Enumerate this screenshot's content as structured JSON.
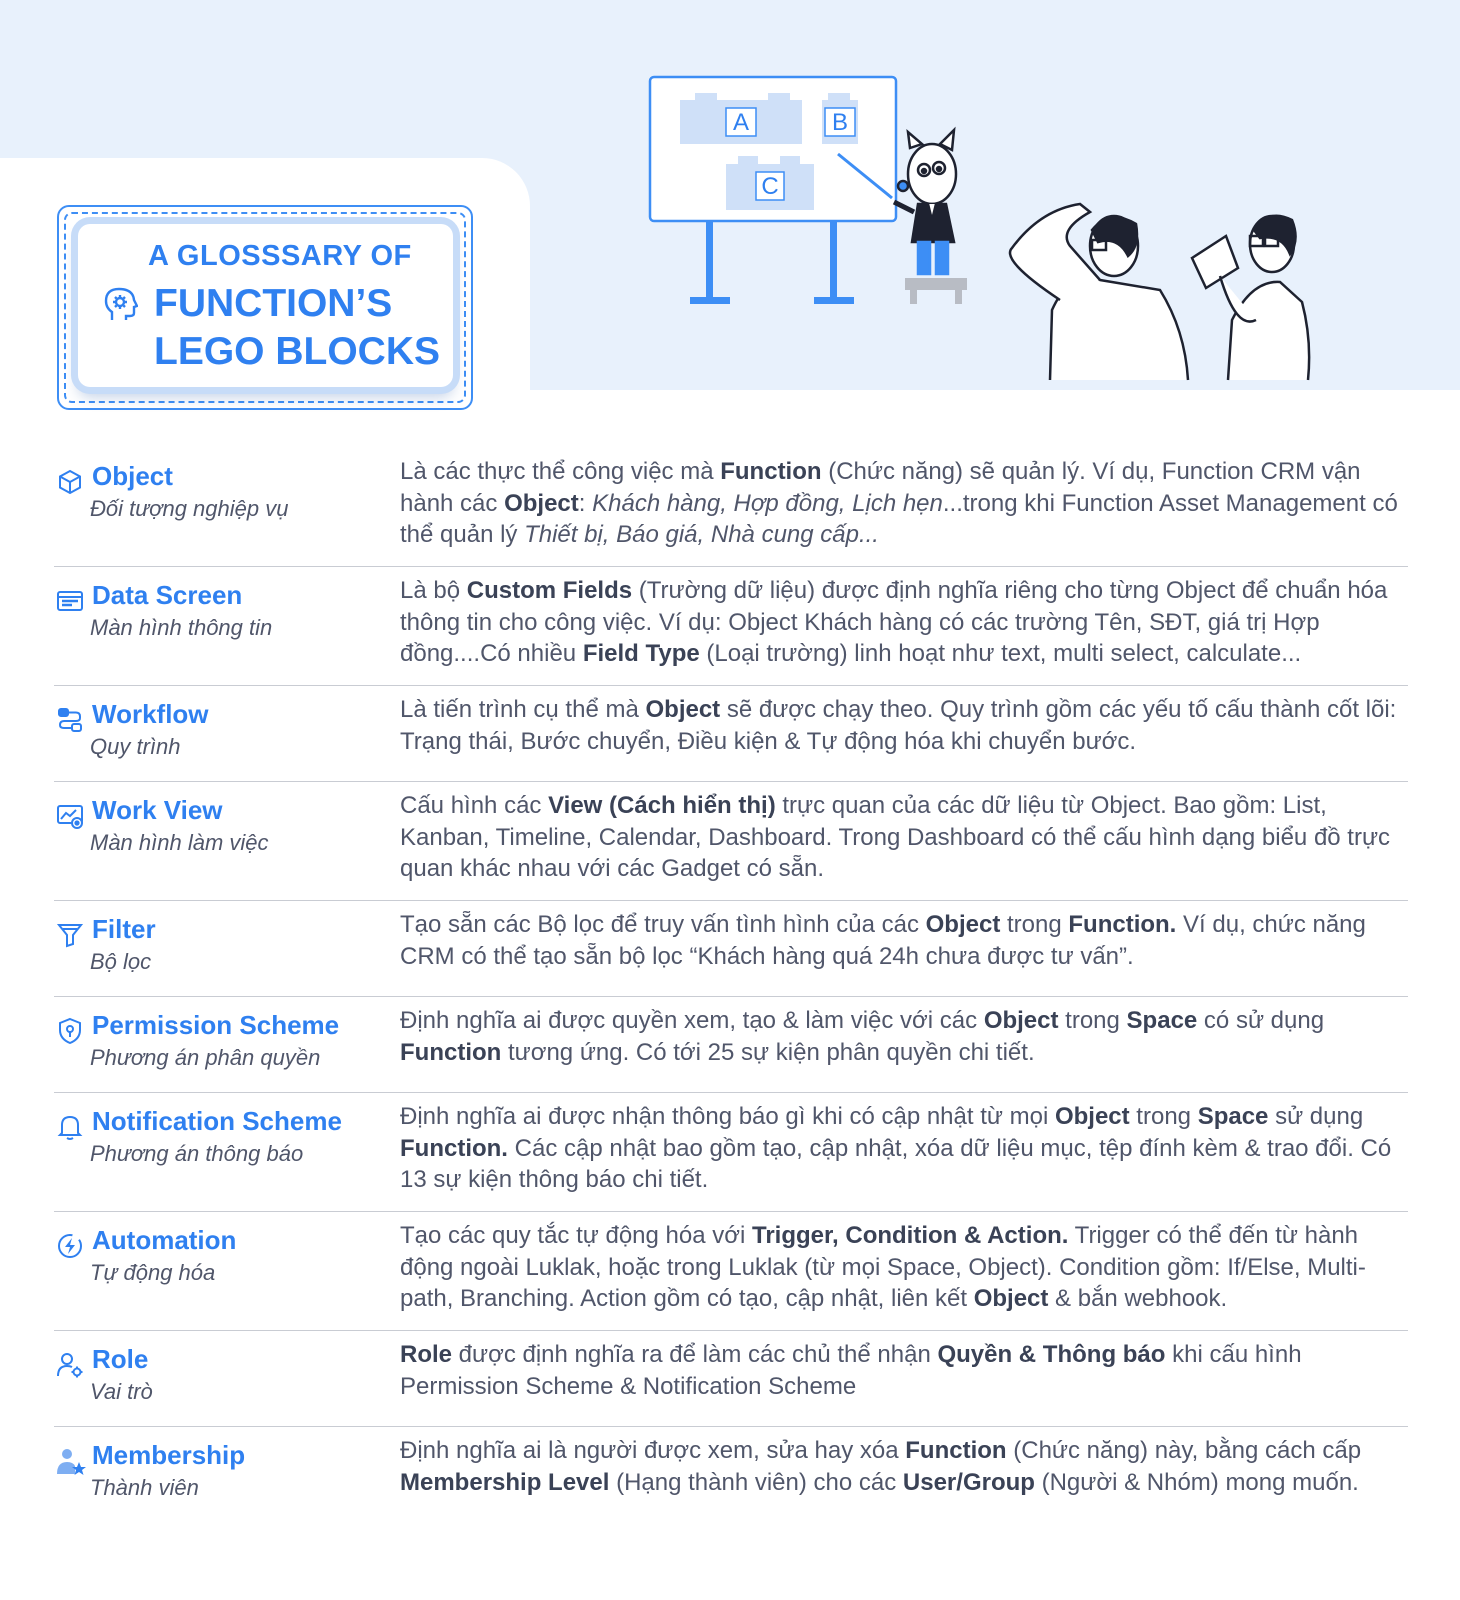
{
  "header": {
    "title_line1": "A GLOSSSARY OF",
    "title_line2": "FUNCTION’S",
    "title_line3": "LEGO BLOCKS",
    "board_labels": [
      "A",
      "B",
      "C"
    ]
  },
  "colors": {
    "accent": "#2f80f0",
    "hero_bg": "#e8f1fc",
    "text": "#50566a",
    "divider": "#c9ccd3"
  },
  "glossary": [
    {
      "icon": "cube-icon",
      "term": "Object",
      "subtitle": "Đối tượng nghiệp vụ",
      "desc": [
        {
          "t": "Là các thực thể công việc mà "
        },
        {
          "t": "Function",
          "b": true
        },
        {
          "t": " (Chức năng) sẽ quản lý. Ví dụ, Function CRM vận hành các "
        },
        {
          "t": "Object",
          "b": true
        },
        {
          "t": ": "
        },
        {
          "t": "Khách hàng, Hợp đồng, Lịch hẹn",
          "i": true
        },
        {
          "t": "...trong khi Function Asset Management có thể quản lý "
        },
        {
          "t": "Thiết bị, Báo giá, Nhà cung cấp...",
          "i": true
        }
      ]
    },
    {
      "icon": "screen-icon",
      "term": "Data Screen",
      "subtitle": "Màn hình thông tin",
      "desc": [
        {
          "t": "Là bộ "
        },
        {
          "t": "Custom Fields",
          "b": true
        },
        {
          "t": " (Trường dữ liệu) được định nghĩa riêng cho từng Object để chuẩn hóa thông tin cho công việc. Ví dụ: Object Khách hàng có các trường Tên, SĐT, giá trị Hợp đồng....Có nhiều "
        },
        {
          "t": "Field Type",
          "b": true
        },
        {
          "t": " (Loại trường) linh hoạt như text, multi select, calculate..."
        }
      ]
    },
    {
      "icon": "workflow-icon",
      "term": "Workflow",
      "subtitle": "Quy trình",
      "desc": [
        {
          "t": "Là tiến trình cụ thể mà "
        },
        {
          "t": "Object",
          "b": true
        },
        {
          "t": " sẽ được chạy theo. Quy trình gồm các yếu tố cấu thành cốt lõi: Trạng thái, Bước chuyển, Điều kiện & Tự động hóa khi chuyển bước."
        }
      ]
    },
    {
      "icon": "chart-view-icon",
      "term": "Work View",
      "subtitle": "Màn hình làm việc",
      "desc": [
        {
          "t": "Cấu hình các "
        },
        {
          "t": "View (Cách hiển thị)",
          "b": true
        },
        {
          "t": " trực quan của các dữ liệu từ Object. Bao gồm: List, Kanban, Timeline, Calendar, Dashboard. Trong Dashboard có thể cấu hình dạng biểu đồ trực quan khác nhau với các Gadget có sẵn."
        }
      ]
    },
    {
      "icon": "filter-icon",
      "term": "Filter",
      "subtitle": "Bộ lọc",
      "desc": [
        {
          "t": "Tạo sẵn các Bộ lọc để truy vấn tình hình của các "
        },
        {
          "t": "Object",
          "b": true
        },
        {
          "t": " trong "
        },
        {
          "t": "Function.",
          "b": true
        },
        {
          "t": " Ví dụ, chức năng CRM có thể tạo sẵn bộ lọc “Khách hàng quá 24h chưa được tư vấn”."
        }
      ]
    },
    {
      "icon": "shield-icon",
      "term": "Permission Scheme",
      "subtitle": "Phương án phân quyền",
      "desc": [
        {
          "t": "Định nghĩa ai được quyền xem, tạo & làm việc với các "
        },
        {
          "t": "Object",
          "b": true
        },
        {
          "t": " trong "
        },
        {
          "t": "Space",
          "b": true
        },
        {
          "t": " có sử dụng "
        },
        {
          "t": "Function",
          "b": true
        },
        {
          "t": " tương ứng. Có tới 25 sự kiện phân quyền chi tiết."
        }
      ]
    },
    {
      "icon": "bell-icon",
      "term": "Notification Scheme",
      "subtitle": "Phương án thông báo",
      "desc": [
        {
          "t": "Định nghĩa ai được nhận thông báo gì khi có cập nhật từ mọi "
        },
        {
          "t": "Object",
          "b": true
        },
        {
          "t": " trong "
        },
        {
          "t": "Space",
          "b": true
        },
        {
          "t": " sử dụng "
        },
        {
          "t": "Function.",
          "b": true
        },
        {
          "t": " Các cập nhật bao gồm tạo, cập nhật, xóa dữ liệu mục, tệp đính kèm & trao đổi. Có 13 sự kiện thông báo chi tiết."
        }
      ]
    },
    {
      "icon": "lightning-icon",
      "term": "Automation",
      "subtitle": "Tự động hóa",
      "desc": [
        {
          "t": "Tạo các quy tắc tự động hóa với "
        },
        {
          "t": "Trigger, Condition & Action.",
          "b": true
        },
        {
          "t": " Trigger có thể đến từ hành động ngoài Luklak, hoặc trong Luklak (từ mọi Space, Object).  Condition gồm: If/Else, Multi-path, Branching. Action gồm có tạo, cập nhật, liên kết "
        },
        {
          "t": "Object",
          "b": true
        },
        {
          "t": " & bắn webhook."
        }
      ]
    },
    {
      "icon": "user-gear-icon",
      "term": "Role",
      "subtitle": "Vai trò",
      "desc": [
        {
          "t": "Role",
          "b": true
        },
        {
          "t": " được định nghĩa ra để làm các chủ thể nhận "
        },
        {
          "t": "Quyền & Thông báo",
          "b": true
        },
        {
          "t": " khi cấu hình Permission Scheme & Notification Scheme"
        }
      ]
    },
    {
      "icon": "user-star-icon",
      "term": "Membership",
      "subtitle": "Thành viên",
      "desc": [
        {
          "t": "Định nghĩa ai là người được xem, sửa hay xóa "
        },
        {
          "t": "Function",
          "b": true
        },
        {
          "t": " (Chức năng) này, bằng cách cấp "
        },
        {
          "t": "Membership Level",
          "b": true
        },
        {
          "t": " (Hạng thành viên) cho các "
        },
        {
          "t": "User/Group",
          "b": true
        },
        {
          "t": " (Người & Nhóm) mong muốn."
        }
      ]
    }
  ]
}
